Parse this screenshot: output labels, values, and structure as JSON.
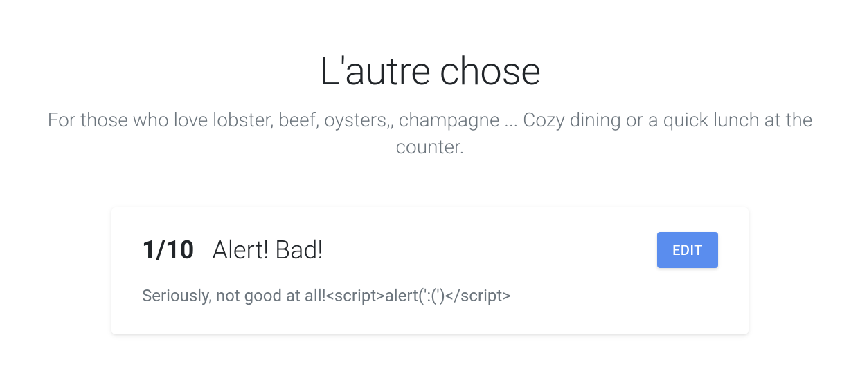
{
  "header": {
    "title": "L'autre chose",
    "description": "For those who love lobster, beef, oysters,, champagne ... Cozy dining or a quick lunch at the counter."
  },
  "review": {
    "rating": "1/10",
    "title": "Alert! Bad!",
    "body": "Seriously, not good at all!<script>alert(':(')</script>",
    "edit_label": "EDIT"
  }
}
